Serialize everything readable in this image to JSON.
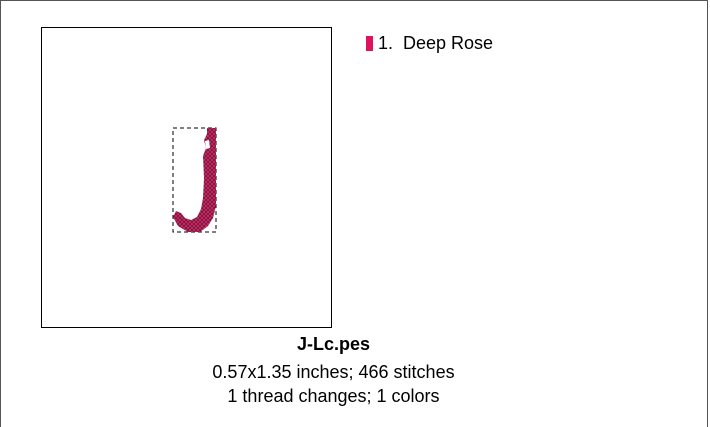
{
  "thread_list": [
    {
      "index": "1.",
      "name": "Deep Rose",
      "color": "#e0115f"
    }
  ],
  "stitch_color": "#c8326a",
  "file": {
    "name": "J-Lc.pes",
    "dimensions_text": "0.57x1.35 inches; 466 stitches",
    "threads_text": "1 thread changes; 1 colors"
  }
}
